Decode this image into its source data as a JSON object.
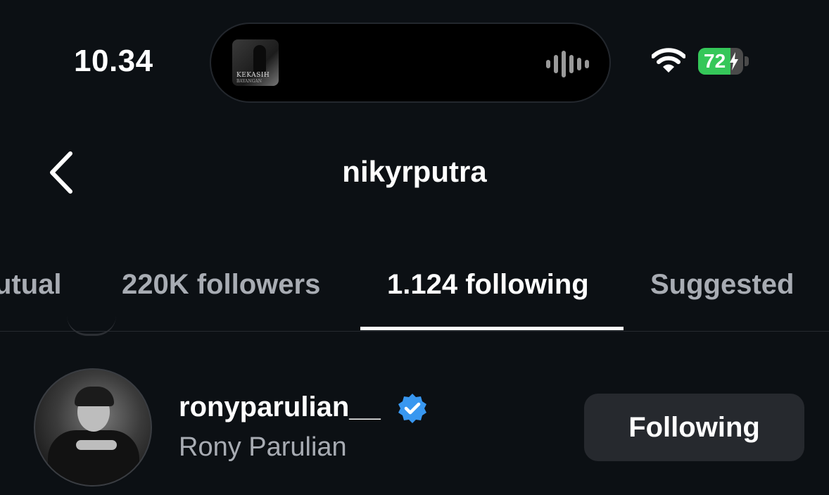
{
  "status_bar": {
    "time": "10.34",
    "now_playing": {
      "album_text": "KEKASIH",
      "album_subtext": "BAYANGAN",
      "icon": "audio-waveform-icon"
    },
    "wifi_icon": "wifi-icon",
    "battery": {
      "percent": "72",
      "level": 0.72,
      "charging": true,
      "color": "#35c759"
    }
  },
  "header": {
    "back_icon": "chevron-left-icon",
    "title": "nikyrputra"
  },
  "tabs": [
    {
      "label": "utual",
      "active": false
    },
    {
      "label": "220K followers",
      "active": false
    },
    {
      "label": "1.124 following",
      "active": true
    },
    {
      "label": "Suggested",
      "active": false
    }
  ],
  "list": [
    {
      "username": "ronyparulian__",
      "verified": true,
      "verified_color": "#3897f0",
      "full_name": "Rony Parulian",
      "button_label": "Following"
    }
  ]
}
